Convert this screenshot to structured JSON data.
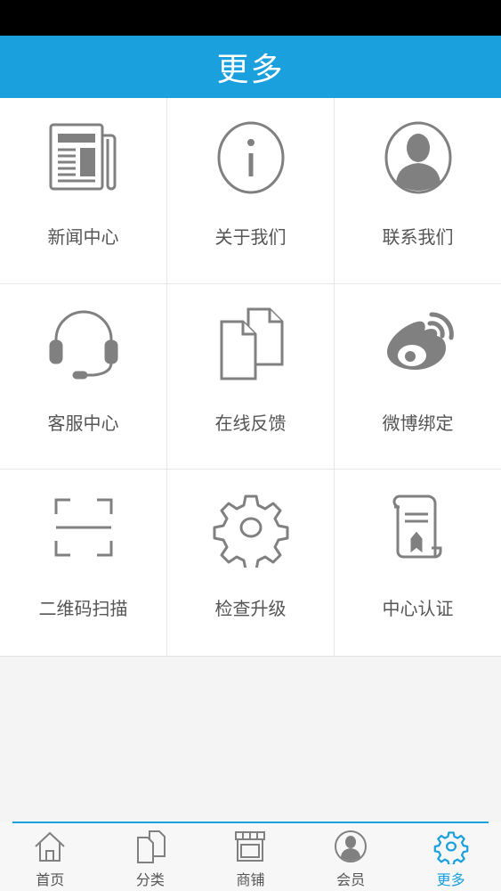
{
  "header": {
    "title": "更多"
  },
  "grid": {
    "items": [
      {
        "label": "新闻中心",
        "icon": "newspaper-icon"
      },
      {
        "label": "关于我们",
        "icon": "info-icon"
      },
      {
        "label": "联系我们",
        "icon": "person-silhouette-icon"
      },
      {
        "label": "客服中心",
        "icon": "headset-icon"
      },
      {
        "label": "在线反馈",
        "icon": "documents-icon"
      },
      {
        "label": "微博绑定",
        "icon": "weibo-icon"
      },
      {
        "label": "二维码扫描",
        "icon": "qr-scan-icon"
      },
      {
        "label": "检查升级",
        "icon": "gear-icon"
      },
      {
        "label": "中心认证",
        "icon": "certificate-scroll-icon"
      }
    ]
  },
  "tabbar": {
    "items": [
      {
        "label": "首页",
        "icon": "home-icon"
      },
      {
        "label": "分类",
        "icon": "documents-icon"
      },
      {
        "label": "商铺",
        "icon": "store-icon"
      },
      {
        "label": "会员",
        "icon": "member-icon"
      },
      {
        "label": "更多",
        "icon": "gear-icon",
        "active": true
      }
    ]
  },
  "colors": {
    "accent": "#1aa0dc",
    "icon_gray": "#808080",
    "status_bar": "#000000"
  }
}
